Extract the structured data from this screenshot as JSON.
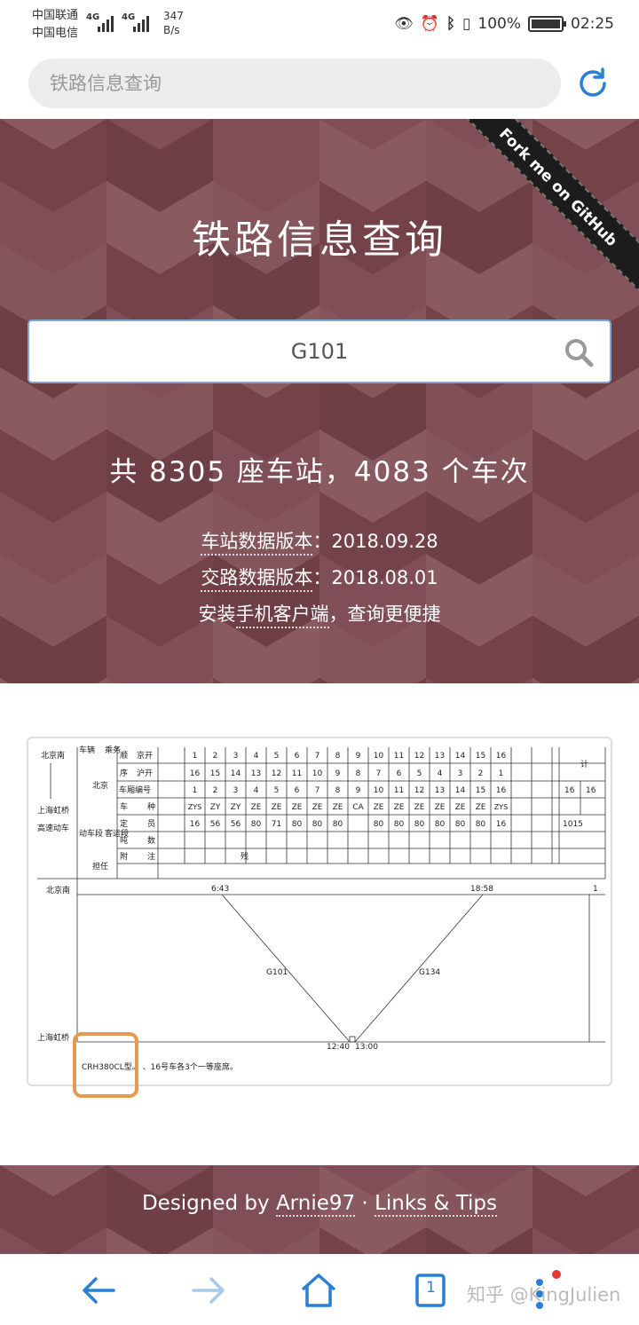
{
  "status_bar": {
    "carrier_1": "中国联通",
    "carrier_2": "中国电信",
    "net_1": "4G",
    "net_2": "4G",
    "speed_value": "347",
    "speed_unit": "B/s",
    "battery": "100%",
    "battery_level": 1.0,
    "time": "02:25"
  },
  "browser": {
    "url_text": "铁路信息查询"
  },
  "hero": {
    "ribbon": "Fork me on GitHub",
    "title": "铁路信息查询",
    "search_value": "G101",
    "stats": "共 8305 座车站，4083 个车次",
    "station_label": "车站数据版本",
    "station_version": "：2018.09.28",
    "route_label": "交路数据版本",
    "route_version": "：2018.08.01",
    "app_prefix": "安装",
    "app_link": "手机客户端",
    "app_suffix": "，查询更便捷"
  },
  "result": {
    "left_labels": [
      "北京南",
      "上海虹桥",
      "高速动车"
    ],
    "col_labels": {
      "vehicle": "车辆",
      "crew": "乘务",
      "beijing": "北京",
      "emu": "动车段",
      "passenger": "客运段",
      "duty": "担任",
      "order": "顺",
      "order2": "序",
      "jingkai": "京开",
      "hukai": "沪开",
      "car_no": "车厢编号",
      "car_type_1": "车",
      "car_type_2": "种",
      "seats_1": "定",
      "seats_2": "员",
      "tons_1": "吨",
      "tons_2": "数",
      "notes_1": "附",
      "notes_2": "注",
      "total": "计"
    },
    "row_jingkai": [
      "1",
      "2",
      "3",
      "4",
      "5",
      "6",
      "7",
      "8",
      "9",
      "10",
      "11",
      "12",
      "13",
      "14",
      "15",
      "16"
    ],
    "row_hukai": [
      "16",
      "15",
      "14",
      "13",
      "12",
      "11",
      "10",
      "9",
      "8",
      "7",
      "6",
      "5",
      "4",
      "3",
      "2",
      "1"
    ],
    "row_carno": [
      "1",
      "2",
      "3",
      "4",
      "5",
      "6",
      "7",
      "8",
      "9",
      "10",
      "11",
      "12",
      "13",
      "14",
      "15",
      "16"
    ],
    "row_type": [
      "ZYS",
      "ZY",
      "ZY",
      "ZE",
      "ZE",
      "ZE",
      "ZE",
      "ZE",
      "CA",
      "ZE",
      "ZE",
      "ZE",
      "ZE",
      "ZE",
      "ZE",
      "ZYS"
    ],
    "row_seats": [
      "16",
      "56",
      "56",
      "80",
      "71",
      "80",
      "80",
      "80",
      "",
      "80",
      "80",
      "80",
      "80",
      "80",
      "80",
      "16"
    ],
    "row_notes_mark": "残",
    "total_carno_1": "16",
    "total_carno_2": "16",
    "total_seats": "1015",
    "diagram": {
      "top_station": "北京南",
      "bottom_station": "上海虹桥",
      "t_dep_1": "6:43",
      "t_arr_1": "18:58",
      "t_arr_2": "12:40",
      "t_dep_2": "13:00",
      "train_1": "G101",
      "train_2": "G134",
      "end_mark": "1"
    },
    "note": "CRH380CL型。 、16号车各3个一等座席。"
  },
  "footer": {
    "prefix": "Designed by ",
    "author": "Arnie97",
    "sep": " · ",
    "links": "Links & Tips"
  },
  "nav": {
    "watermark": "知乎 @KingJulien",
    "tab_count": "1"
  },
  "colors": {
    "hero_bg": "#7b4a51",
    "accent_blue": "#2a7fd4",
    "mark_orange": "#e69a4f"
  }
}
